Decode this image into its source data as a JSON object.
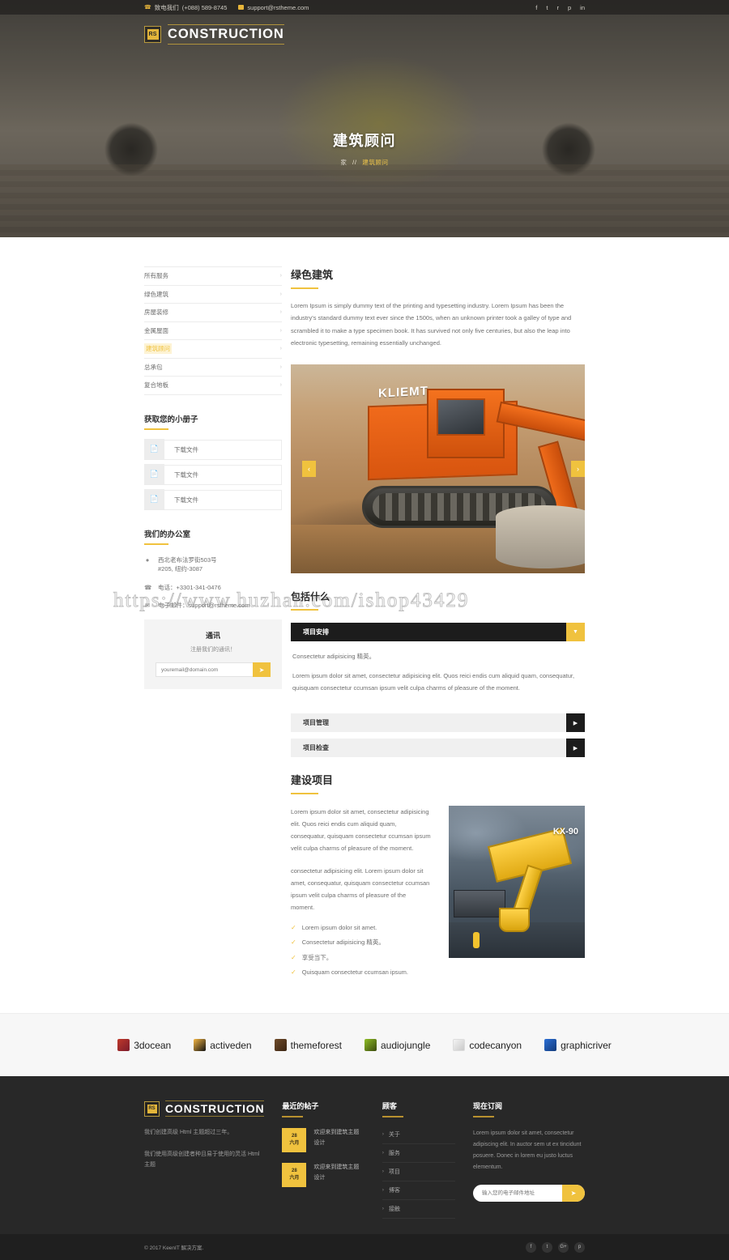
{
  "topbar": {
    "phone_label": "致电我们",
    "phone": "(+088) 589-8745",
    "email": "support@rstheme.com",
    "socials": [
      "f",
      "t",
      "r",
      "p",
      "in"
    ]
  },
  "brand": {
    "badge": "RS",
    "name": "CONSTRUCTION"
  },
  "hero": {
    "title": "建筑顾问",
    "breadcrumb_home": "家",
    "breadcrumb_sep": "//",
    "breadcrumb_current": "建筑顾问"
  },
  "sidebar": {
    "services": [
      {
        "label": "所有服务",
        "active": false
      },
      {
        "label": "绿色建筑",
        "active": false
      },
      {
        "label": "房屋装修",
        "active": false
      },
      {
        "label": "金属屋面",
        "active": false
      },
      {
        "label": "建筑顾问",
        "active": true
      },
      {
        "label": "总承包",
        "active": false
      },
      {
        "label": "复合地板",
        "active": false
      }
    ],
    "brochure_title": "获取您的小册子",
    "downloads": [
      {
        "label": "下载文件"
      },
      {
        "label": "下载文件"
      },
      {
        "label": "下载文件"
      }
    ],
    "office_title": "我们的办公室",
    "address_line1": "西北老布法罗街503号",
    "address_line2": "#205, 纽约-3087",
    "phone_line": "电话：+3301-341-0476",
    "email_line": "电子邮件：support@rstheme.com",
    "newsletter_title": "通讯",
    "newsletter_sub": "注册我们的通讯！",
    "newsletter_placeholder": "youremail@domain.com",
    "newsletter_button": "➤"
  },
  "content": {
    "heading": "绿色建筑",
    "intro": "Lorem Ipsum is simply dummy text of the printing and typesetting industry. Lorem Ipsum has been the industry's standard dummy text ever since the 1500s, when an unknown printer took a galley of type and scrambled it to make a type specimen book. It has survived not only five centuries, but also the leap into electronic typesetting, remaining essentially unchanged.",
    "slider_caption": "KLIEMT",
    "slider_prev": "‹",
    "slider_next": "›",
    "accordion_heading": "包括什么",
    "accordion": [
      {
        "title": "项目安排",
        "open": true,
        "icon": "▼",
        "body_1": "Consectetur adipisicing 精英。",
        "body_2": "Lorem ipsum dolor sit amet, consectetur adipisicing elit. Quos reici endis cum aliquid quam, consequatur, quisquam consectetur ccumsan ipsum velit culpa charms of pleasure of the moment."
      },
      {
        "title": "项目管理",
        "open": false,
        "icon": "▶"
      },
      {
        "title": "项目检查",
        "open": false,
        "icon": "▶"
      }
    ],
    "projects_heading": "建设项目",
    "projects_p1": "Lorem ipsum dolor sit amet, consectetur adipisicing elit. Quos reici endis cum aliquid quam, consequatur, quisquam consectetur ccumsan ipsum velit culpa charms of pleasure of the moment.",
    "projects_p2": "consectetur adipisicing elit. Lorem ipsum dolor sit amet, consequatur, quisquam consectetur ccumsan ipsum velit culpa charms of pleasure of the moment.",
    "checklist": [
      "Lorem ipsum dolor sit amet.",
      "Consectetur adipisicing 精英。",
      "享受当下。",
      "Quisquam consectetur ccumsan ipsum."
    ],
    "project_img_label": "KX-90"
  },
  "watermark": "https://www.huzhan.com/ishop43429",
  "brands": [
    {
      "name": "3docean",
      "cls": "bi-3docean"
    },
    {
      "name": "activeden",
      "cls": "bi-activeden"
    },
    {
      "name": "themeforest",
      "cls": "bi-themeforest"
    },
    {
      "name": "audiojungle",
      "cls": "bi-audiojungle"
    },
    {
      "name": "codecanyon",
      "cls": "bi-codecanyon"
    },
    {
      "name": "graphicriver",
      "cls": "bi-graphicriver"
    }
  ],
  "footer": {
    "about_p1": "我们创建高级 Html 主题超过三年。",
    "about_p2": "我们使用高级创建者种且易于使用的灵活 Html 主题",
    "posts_title": "最近的帖子",
    "posts": [
      {
        "day": "28",
        "month": "六月",
        "text": "欢迎来到建筑主题设计"
      },
      {
        "day": "28",
        "month": "六月",
        "text": "欢迎来到建筑主题设计"
      }
    ],
    "links_title": "顾客",
    "links": [
      "关于",
      "服务",
      "项目",
      "博客",
      "接触"
    ],
    "subscribe_title": "现在订阅",
    "subscribe_text": "Lorem ipsum dolor sit amet, consectetur adipiscing elit. In auctor sem ut ex tincidunt posuere. Donec in lorem eu justo luctus elementum.",
    "subscribe_placeholder": "输入您的电子邮件地址",
    "subscribe_button": "➤",
    "copyright": "© 2017 KeenIT 解决方案.",
    "copy_socials": [
      "f",
      "t",
      "G+",
      "p"
    ]
  }
}
